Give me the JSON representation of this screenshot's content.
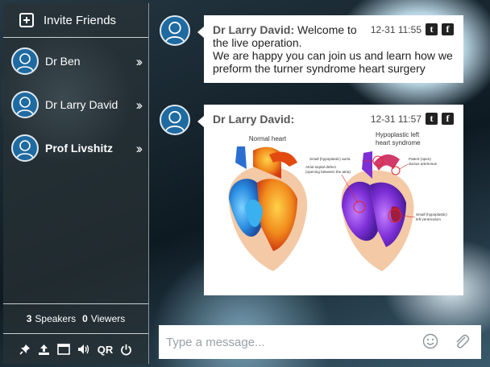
{
  "sidebar": {
    "invite_label": "Invite Friends",
    "contacts": [
      {
        "name": "Dr Ben",
        "bold": false
      },
      {
        "name": "Dr Larry David",
        "bold": false
      },
      {
        "name": "Prof Livshitz",
        "bold": true
      }
    ],
    "stats": {
      "speakers_count": "3",
      "speakers_label": "Speakers",
      "viewers_count": "0",
      "viewers_label": "Viewers"
    },
    "toolbar": {
      "icons": [
        "pin-icon",
        "upload-icon",
        "window-icon",
        "volume-icon",
        "qr-icon",
        "power-icon"
      ],
      "qr_label": "QR"
    }
  },
  "messages": [
    {
      "sender": "Dr Larry David:",
      "text_inline": " Welcome to the live operation.",
      "text_line2": "We are happy you can join us and learn how we preform the turner syndrome heart surgery",
      "time": "12-31 11:55",
      "share": [
        "twitter-icon",
        "facebook-icon"
      ]
    },
    {
      "sender": "Dr Larry David:",
      "time": "12-31 11:57",
      "share": [
        "twitter-icon",
        "facebook-icon"
      ],
      "image": {
        "left_title": "Normal heart",
        "right_title_line1": "Hypoplastic left",
        "right_title_line2": "heart syndrome",
        "labels": {
          "aorta": "Small (hypoplastic) aorta",
          "asd_line1": "Atrial septal defect",
          "asd_line2": "(opening between the atria)",
          "pda_line1": "Patent (open)",
          "pda_line2": "ductus arteriosus",
          "lv_line1": "Small (hypoplastic)",
          "lv_line2": "left ventriculum"
        }
      }
    }
  ],
  "composer": {
    "placeholder": "Type a message...",
    "icons": [
      "smiley-icon",
      "paperclip-icon"
    ]
  },
  "share_labels": {
    "twitter": "t",
    "facebook": "f"
  }
}
